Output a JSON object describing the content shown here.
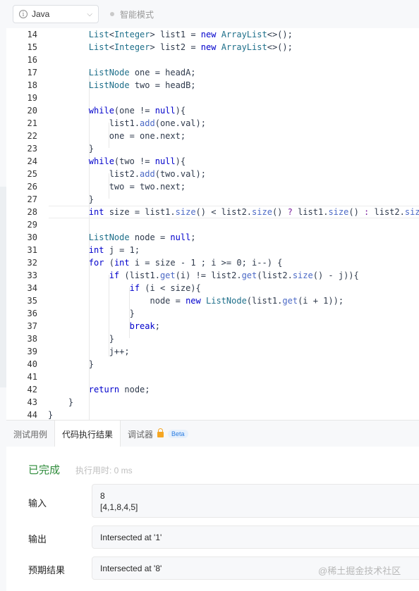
{
  "toolbar": {
    "language": "Java",
    "mode_label": "智能模式"
  },
  "code": [
    {
      "n": "14",
      "tokens": [
        [
          "",
          "        "
        ],
        [
          "t",
          "List"
        ],
        [
          "",
          "<"
        ],
        [
          "t",
          "Integer"
        ],
        [
          "",
          "> list1 = "
        ],
        [
          "k",
          "new"
        ],
        [
          "",
          " "
        ],
        [
          "t",
          "ArrayList"
        ],
        [
          "",
          "<>();"
        ]
      ]
    },
    {
      "n": "15",
      "tokens": [
        [
          "",
          "        "
        ],
        [
          "t",
          "List"
        ],
        [
          "",
          "<"
        ],
        [
          "t",
          "Integer"
        ],
        [
          "",
          "> list2 = "
        ],
        [
          "k",
          "new"
        ],
        [
          "",
          " "
        ],
        [
          "t",
          "ArrayList"
        ],
        [
          "",
          "<>();"
        ]
      ]
    },
    {
      "n": "16",
      "tokens": []
    },
    {
      "n": "17",
      "tokens": [
        [
          "",
          "        "
        ],
        [
          "t",
          "ListNode"
        ],
        [
          "",
          " one = headA;"
        ]
      ]
    },
    {
      "n": "18",
      "tokens": [
        [
          "",
          "        "
        ],
        [
          "t",
          "ListNode"
        ],
        [
          "",
          " two = headB;"
        ]
      ]
    },
    {
      "n": "19",
      "tokens": []
    },
    {
      "n": "20",
      "tokens": [
        [
          "",
          "        "
        ],
        [
          "k",
          "while"
        ],
        [
          "",
          "(one != "
        ],
        [
          "k",
          "null"
        ],
        [
          "",
          "){"
        ]
      ]
    },
    {
      "n": "21",
      "tokens": [
        [
          "",
          "            list1."
        ],
        [
          "f",
          "add"
        ],
        [
          "",
          "(one.val);"
        ]
      ]
    },
    {
      "n": "22",
      "tokens": [
        [
          "",
          "            one = one.next;"
        ]
      ]
    },
    {
      "n": "23",
      "tokens": [
        [
          "",
          "        }"
        ]
      ]
    },
    {
      "n": "24",
      "tokens": [
        [
          "",
          "        "
        ],
        [
          "k",
          "while"
        ],
        [
          "",
          "(two != "
        ],
        [
          "k",
          "null"
        ],
        [
          "",
          "){"
        ]
      ]
    },
    {
      "n": "25",
      "tokens": [
        [
          "",
          "            list2."
        ],
        [
          "f",
          "add"
        ],
        [
          "",
          "(two.val);"
        ]
      ]
    },
    {
      "n": "26",
      "tokens": [
        [
          "",
          "            two = two.next;"
        ]
      ]
    },
    {
      "n": "27",
      "tokens": [
        [
          "",
          "        }"
        ]
      ]
    },
    {
      "n": "28",
      "tokens": [
        [
          "",
          "        "
        ],
        [
          "k",
          "int"
        ],
        [
          "",
          " size = list1."
        ],
        [
          "f",
          "size"
        ],
        [
          "",
          "() < list2."
        ],
        [
          "f",
          "size"
        ],
        [
          "",
          "() "
        ],
        [
          "m",
          "?"
        ],
        [
          "",
          " list1."
        ],
        [
          "f",
          "size"
        ],
        [
          "",
          "() "
        ],
        [
          "m",
          ":"
        ],
        [
          "",
          " list2."
        ],
        [
          "f",
          "size"
        ],
        [
          "",
          "();"
        ]
      ]
    },
    {
      "n": "29",
      "tokens": []
    },
    {
      "n": "30",
      "tokens": [
        [
          "",
          "        "
        ],
        [
          "t",
          "ListNode"
        ],
        [
          "",
          " node = "
        ],
        [
          "k",
          "null"
        ],
        [
          "",
          ";"
        ]
      ]
    },
    {
      "n": "31",
      "tokens": [
        [
          "",
          "        "
        ],
        [
          "k",
          "int"
        ],
        [
          "",
          " j = 1;"
        ]
      ]
    },
    {
      "n": "32",
      "tokens": [
        [
          "",
          "        "
        ],
        [
          "k",
          "for"
        ],
        [
          "",
          " ("
        ],
        [
          "k",
          "int"
        ],
        [
          "",
          " i = size - 1 ; i >= 0; i--) {"
        ]
      ]
    },
    {
      "n": "33",
      "tokens": [
        [
          "",
          "            "
        ],
        [
          "k",
          "if"
        ],
        [
          "",
          " (list1."
        ],
        [
          "f",
          "get"
        ],
        [
          "",
          "(i) != list2."
        ],
        [
          "f",
          "get"
        ],
        [
          "",
          "(list2."
        ],
        [
          "f",
          "size"
        ],
        [
          "",
          "() - j)){"
        ]
      ]
    },
    {
      "n": "34",
      "tokens": [
        [
          "",
          "                "
        ],
        [
          "k",
          "if"
        ],
        [
          "",
          " (i < size){"
        ]
      ]
    },
    {
      "n": "35",
      "tokens": [
        [
          "",
          "                    node = "
        ],
        [
          "k",
          "new"
        ],
        [
          "",
          " "
        ],
        [
          "t",
          "ListNode"
        ],
        [
          "",
          "(list1."
        ],
        [
          "f",
          "get"
        ],
        [
          "",
          "(i + 1));"
        ]
      ]
    },
    {
      "n": "36",
      "tokens": [
        [
          "",
          "                }"
        ]
      ]
    },
    {
      "n": "37",
      "tokens": [
        [
          "",
          "                "
        ],
        [
          "k",
          "break"
        ],
        [
          "",
          ";"
        ]
      ]
    },
    {
      "n": "38",
      "tokens": [
        [
          "",
          "            }"
        ]
      ]
    },
    {
      "n": "39",
      "tokens": [
        [
          "",
          "            j++;"
        ]
      ]
    },
    {
      "n": "40",
      "tokens": [
        [
          "",
          "        }"
        ]
      ]
    },
    {
      "n": "41",
      "tokens": []
    },
    {
      "n": "42",
      "tokens": [
        [
          "",
          "        "
        ],
        [
          "k",
          "return"
        ],
        [
          "",
          " node;"
        ]
      ]
    },
    {
      "n": "43",
      "tokens": [
        [
          "",
          "    }"
        ]
      ]
    },
    {
      "n": "44",
      "tokens": [
        [
          "",
          "}"
        ]
      ]
    }
  ],
  "active_line": "28",
  "tabs": [
    {
      "label": "测试用例"
    },
    {
      "label": "代码执行结果",
      "active": true
    },
    {
      "label": "调试器",
      "badge": "Beta"
    }
  ],
  "result": {
    "status": "已完成",
    "elapsed": "执行用时: 0 ms",
    "input_label": "输入",
    "input_lines": [
      "8",
      "[4,1,8,4,5]"
    ],
    "output_label": "输出",
    "output_value": "Intersected at '1'",
    "expected_label": "预期结果",
    "expected_value": "Intersected at '8'"
  },
  "watermark": "@稀土掘金技术社区",
  "colors": {
    "keyword": "#0000cc",
    "type": "#1e6f8a",
    "method": "#4b69c6",
    "status": "#2e8b3a",
    "beta": "#2a7ce0"
  }
}
